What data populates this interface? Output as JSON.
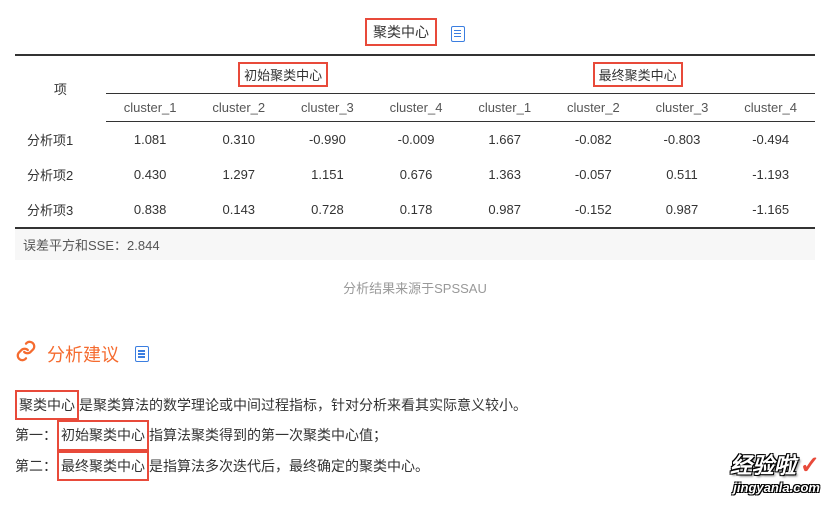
{
  "title": "聚类中心",
  "table": {
    "row_header": "项",
    "group1": "初始聚类中心",
    "group2": "最终聚类中心",
    "sub_headers": [
      "cluster_1",
      "cluster_2",
      "cluster_3",
      "cluster_4",
      "cluster_1",
      "cluster_2",
      "cluster_3",
      "cluster_4"
    ],
    "rows": [
      {
        "label": "分析项1",
        "v": [
          "1.081",
          "0.310",
          "-0.990",
          "-0.009",
          "1.667",
          "-0.082",
          "-0.803",
          "-0.494"
        ]
      },
      {
        "label": "分析项2",
        "v": [
          "0.430",
          "1.297",
          "1.151",
          "0.676",
          "1.363",
          "-0.057",
          "0.511",
          "-1.193"
        ]
      },
      {
        "label": "分析项3",
        "v": [
          "0.838",
          "0.143",
          "0.728",
          "0.178",
          "0.987",
          "-0.152",
          "0.987",
          "-1.165"
        ]
      }
    ],
    "sse": "误差平方和SSE：2.844"
  },
  "source": "分析结果来源于SPSSAU",
  "advice": {
    "title": "分析建议",
    "line1_a": "聚类中心",
    "line1_b": "是聚类算法的数学理论或中间过程指标，针对分析来看其实际意义较小。",
    "line2_a": "第一：",
    "line2_hl": "初始聚类中心",
    "line2_b": "指算法聚类得到的第一次聚类中心值；",
    "line3_a": "第二：",
    "line3_hl": "最终聚类中心",
    "line3_b": "是指算法多次迭代后，最终确定的聚类中心。"
  },
  "watermark": {
    "main": "经验啦",
    "sub": "jingyanla.com"
  },
  "chart_data": {
    "type": "table",
    "title": "聚类中心",
    "columns": [
      "项",
      "初始聚类中心 cluster_1",
      "初始聚类中心 cluster_2",
      "初始聚类中心 cluster_3",
      "初始聚类中心 cluster_4",
      "最终聚类中心 cluster_1",
      "最终聚类中心 cluster_2",
      "最终聚类中心 cluster_3",
      "最终聚类中心 cluster_4"
    ],
    "rows": [
      [
        "分析项1",
        1.081,
        0.31,
        -0.99,
        -0.009,
        1.667,
        -0.082,
        -0.803,
        -0.494
      ],
      [
        "分析项2",
        0.43,
        1.297,
        1.151,
        0.676,
        1.363,
        -0.057,
        0.511,
        -1.193
      ],
      [
        "分析项3",
        0.838,
        0.143,
        0.728,
        0.178,
        0.987,
        -0.152,
        0.987,
        -1.165
      ]
    ],
    "footer": "误差平方和SSE：2.844"
  }
}
